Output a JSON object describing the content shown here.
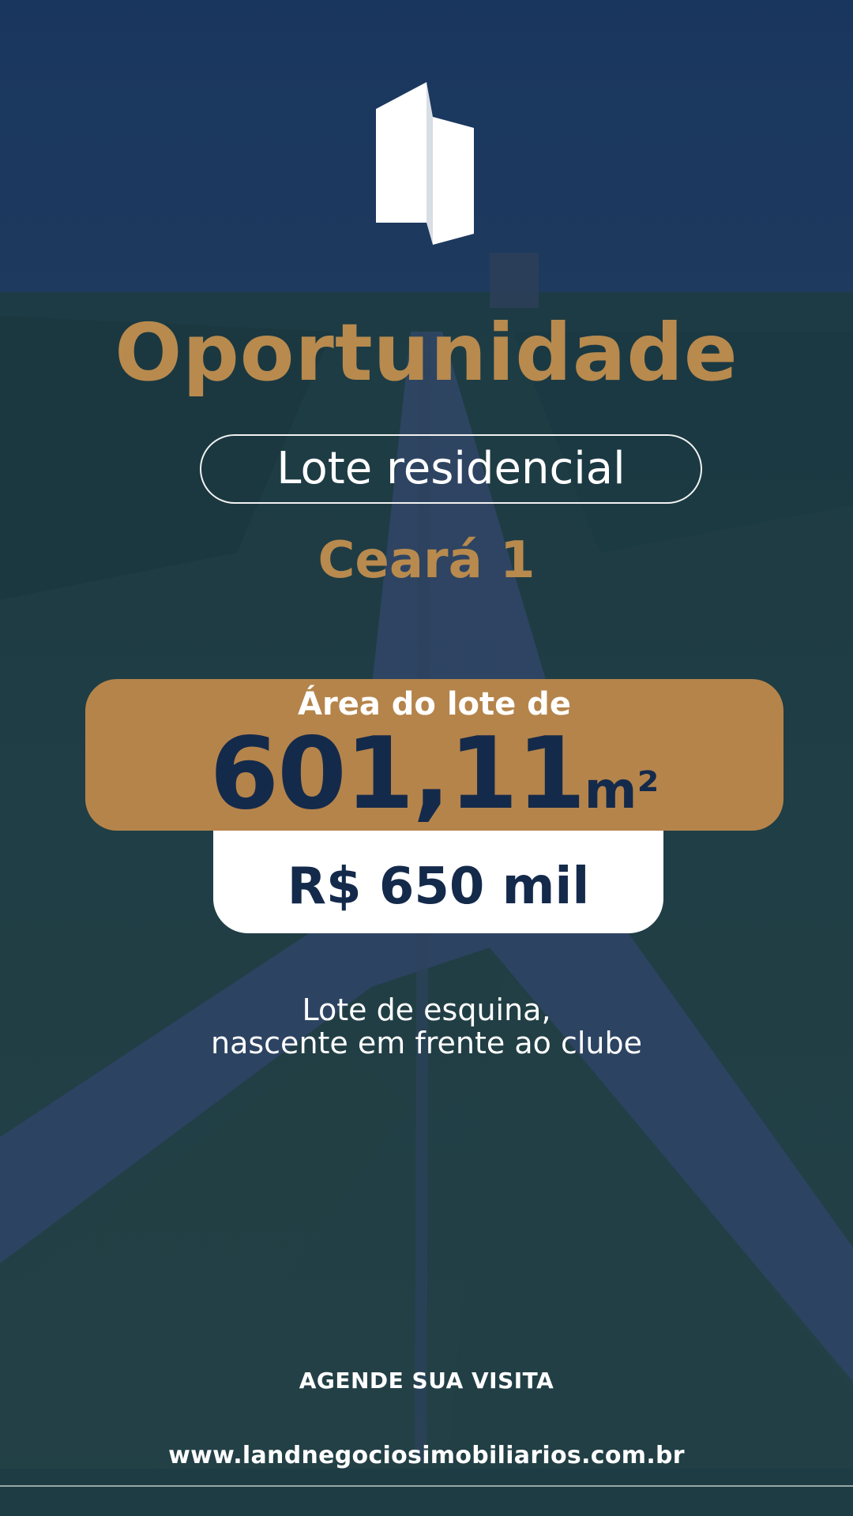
{
  "headline": "Oportunidade",
  "property_type": "Lote residencial",
  "location": "Ceará 1",
  "area": {
    "label": "Área do lote de",
    "value": "601,11",
    "unit": "m²"
  },
  "price": "R$ 650 mil",
  "feature": {
    "line1": "Lote de esquina,",
    "line2": "nascente em frente ao clube"
  },
  "cta": "AGENDE SUA VISITA",
  "website": "www.landnegociosimobiliarios.com.br",
  "colors": {
    "background_navy": "#17325a",
    "accent_gold": "#b5844b",
    "text_navy": "#142a4b",
    "white": "#ffffff"
  },
  "icons": {
    "logo": "building-logo-icon"
  }
}
